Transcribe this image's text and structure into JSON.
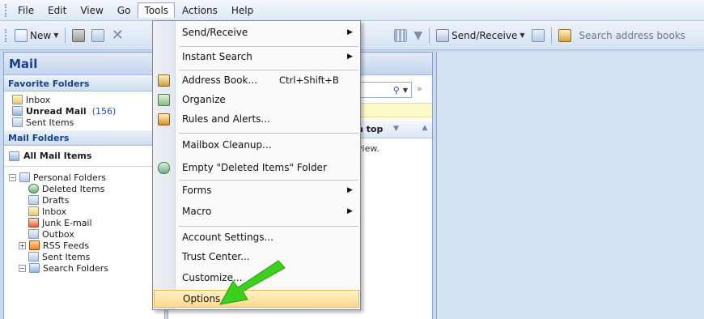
{
  "menubar": {
    "items": [
      "File",
      "Edit",
      "View",
      "Go",
      "Tools",
      "Actions",
      "Help"
    ],
    "active": "Tools"
  },
  "toolbar": {
    "new_label": "New",
    "send_receive_label": "Send/Receive",
    "search_placeholder": "Search address books"
  },
  "nav": {
    "title": "Mail",
    "favorites_header": "Favorite Folders",
    "favorites": [
      {
        "label": "Inbox",
        "bold": false,
        "count": ""
      },
      {
        "label": "Unread Mail",
        "bold": true,
        "count": "(156)"
      },
      {
        "label": "Sent Items",
        "bold": false,
        "count": ""
      }
    ],
    "mail_folders_header": "Mail Folders",
    "all_mail_items": "All Mail Items",
    "tree_root": "Personal Folders",
    "tree": [
      "Deleted Items",
      "Drafts",
      "Inbox",
      "Junk E-mail",
      "Outbox",
      "RSS Feeds",
      "Sent Items",
      "Search Folders"
    ]
  },
  "mail_list": {
    "arrange_label": "n top",
    "empty_text": "view."
  },
  "tools_menu": {
    "items": [
      {
        "label": "Send/Receive",
        "shortcut": "",
        "submenu": true,
        "icon": ""
      },
      {
        "label": "Instant Search",
        "shortcut": "",
        "submenu": true,
        "icon": ""
      },
      {
        "label": "Address Book...",
        "shortcut": "Ctrl+Shift+B",
        "submenu": false,
        "icon": "address-book-icon"
      },
      {
        "label": "Organize",
        "shortcut": "",
        "submenu": false,
        "icon": "organize-icon"
      },
      {
        "label": "Rules and Alerts...",
        "shortcut": "",
        "submenu": false,
        "icon": "rules-icon"
      },
      {
        "label": "Mailbox Cleanup...",
        "shortcut": "",
        "submenu": false,
        "icon": ""
      },
      {
        "label": "Empty \"Deleted Items\" Folder",
        "shortcut": "",
        "submenu": false,
        "icon": "deleted-items-icon"
      },
      {
        "label": "Forms",
        "shortcut": "",
        "submenu": true,
        "icon": ""
      },
      {
        "label": "Macro",
        "shortcut": "",
        "submenu": true,
        "icon": ""
      },
      {
        "label": "Account Settings...",
        "shortcut": "",
        "submenu": false,
        "icon": ""
      },
      {
        "label": "Trust Center...",
        "shortcut": "",
        "submenu": false,
        "icon": ""
      },
      {
        "label": "Customize...",
        "shortcut": "",
        "submenu": false,
        "icon": ""
      },
      {
        "label": "Options...",
        "shortcut": "",
        "submenu": false,
        "icon": "",
        "highlighted": true
      }
    ]
  },
  "colors": {
    "menu_highlight": "#ffd98c",
    "pointer_arrow": "#3ccf1e"
  }
}
